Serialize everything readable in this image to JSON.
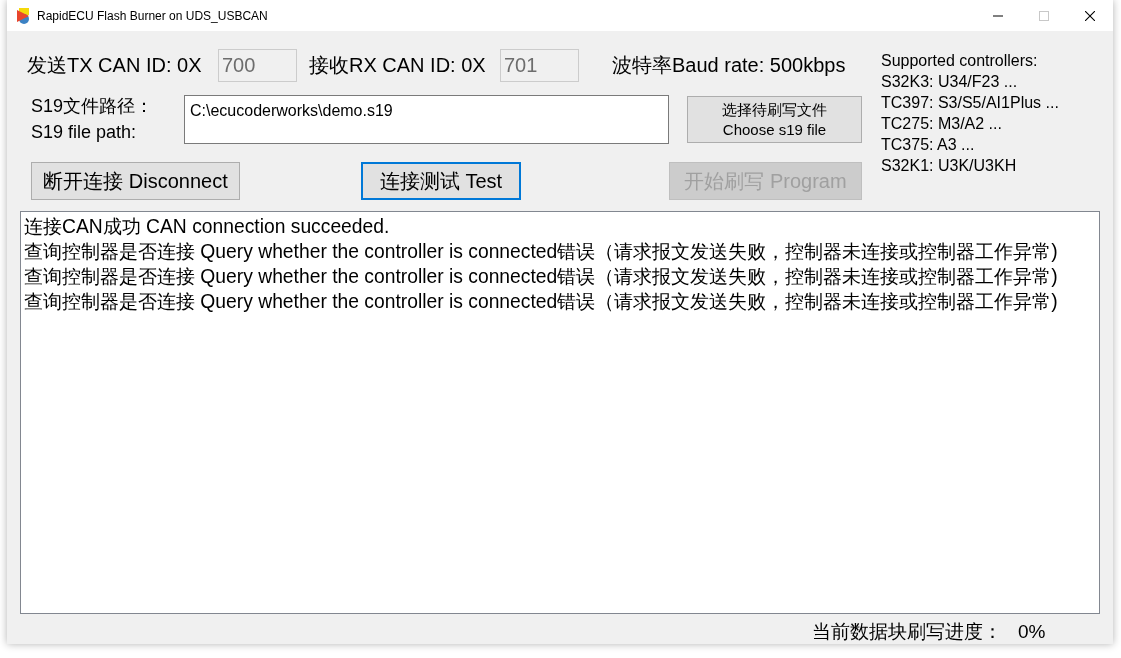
{
  "window": {
    "title": "RapidECU Flash Burner on UDS_USBCAN",
    "controls": [
      {
        "kind": "minimize",
        "disabled": false
      },
      {
        "kind": "maximize",
        "disabled": true
      },
      {
        "kind": "close",
        "disabled": false
      }
    ]
  },
  "can_ids": [
    {
      "label": "发送TX CAN ID: 0X",
      "value": "700",
      "disabled": true
    },
    {
      "label": "接收RX CAN ID: 0X",
      "value": "701",
      "disabled": true
    }
  ],
  "baud_rate": "波特率Baud rate: 500kbps",
  "supported_controllers": {
    "title": "Supported controllers:",
    "items": [
      "S32K3: U34/F23 ...",
      "TC397: S3/S5/AI1Plus ...",
      "TC275: M3/A2 ...",
      "TC375: A3 ...",
      "S32K1: U3K/U3KH"
    ]
  },
  "file_path": {
    "labels": [
      "S19文件路径：",
      "S19 file path:"
    ],
    "value": "C:\\ecucoderworks\\demo.s19"
  },
  "choose_file_button": {
    "lines": [
      "选择待刷写文件",
      "Choose s19 file"
    ]
  },
  "buttons": [
    {
      "label": "断开连接 Disconnect",
      "focused": false,
      "disabled": false
    },
    {
      "label": "连接测试 Test",
      "focused": true,
      "disabled": false
    },
    {
      "label": "开始刷写 Program",
      "focused": false,
      "disabled": true
    }
  ],
  "log": [
    "连接CAN成功 CAN connection succeeded.",
    "查询控制器是否连接 Query whether the controller is connected错误（请求报文发送失败，控制器未连接或控制器工作异常)",
    "查询控制器是否连接 Query whether the controller is connected错误（请求报文发送失败，控制器未连接或控制器工作异常)",
    "查询控制器是否连接 Query whether the controller is connected错误（请求报文发送失败，控制器未连接或控制器工作异常)"
  ],
  "progress": {
    "label": "当前数据块刷写进度：",
    "value": "0%"
  }
}
